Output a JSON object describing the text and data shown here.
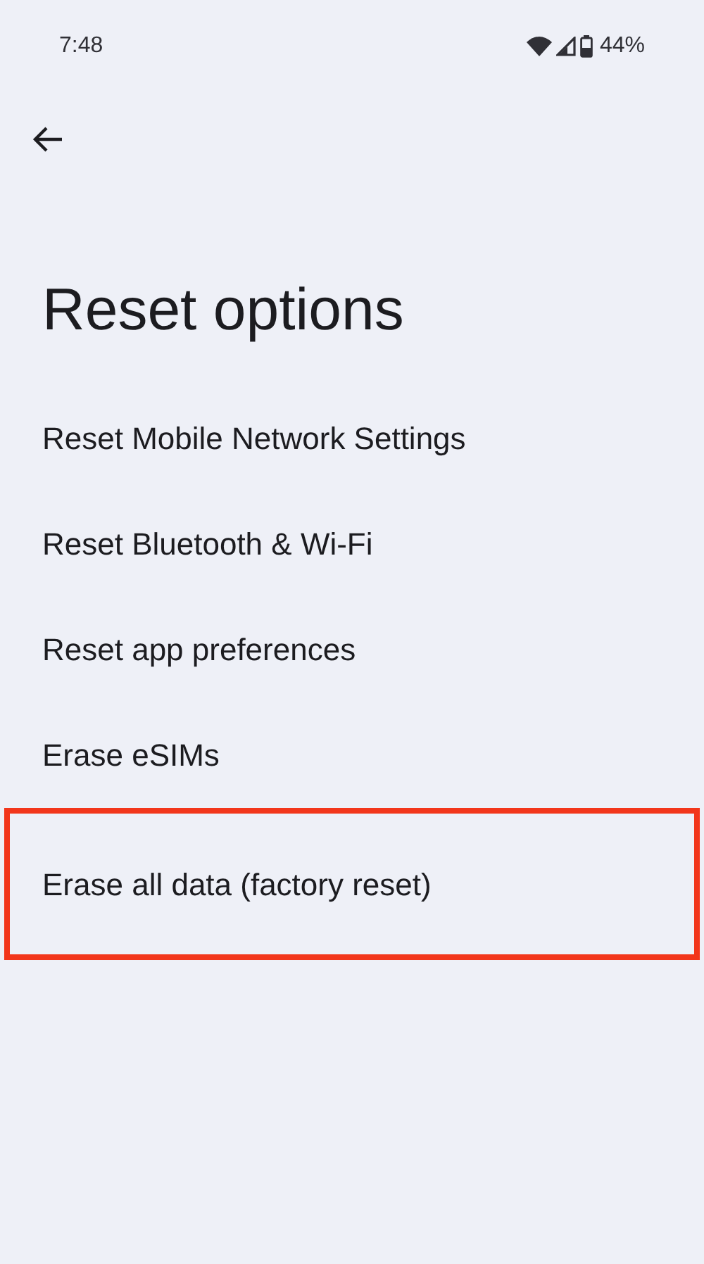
{
  "status_bar": {
    "time": "7:48",
    "battery": "44%"
  },
  "title": "Reset options",
  "items": [
    {
      "label": "Reset Mobile Network Settings",
      "highlighted": false
    },
    {
      "label": "Reset Bluetooth & Wi-Fi",
      "highlighted": false
    },
    {
      "label": "Reset app preferences",
      "highlighted": false
    },
    {
      "label": "Erase eSIMs",
      "highlighted": false
    },
    {
      "label": "Erase all data (factory reset)",
      "highlighted": true
    }
  ]
}
